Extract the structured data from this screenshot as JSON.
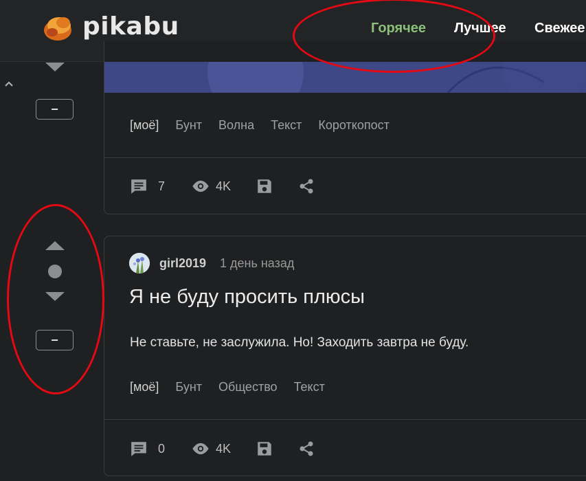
{
  "header": {
    "logo_text": "pikabu",
    "tabs": [
      {
        "label": "Горячее",
        "active": true
      },
      {
        "label": "Лучшее",
        "active": false
      },
      {
        "label": "Свежее",
        "active": false
      }
    ],
    "accent_color": "#8ac07a"
  },
  "rail": {
    "top_minus_label": "−",
    "bottom_minus_label": "−"
  },
  "post_top": {
    "tags": [
      "[моё]",
      "Бунт",
      "Волна",
      "Текст",
      "Короткопост"
    ],
    "comments": "7",
    "views": "4K"
  },
  "post_bottom": {
    "author": "girl2019",
    "time": "1 день назад",
    "title": "Я не буду просить плюсы",
    "body": "Не ставьте, не заслужила. Но! Заходить завтра не буду.",
    "tags": [
      "[моё]",
      "Бунт",
      "Общество",
      "Текст"
    ],
    "comments": "0",
    "views": "4K"
  },
  "icons": {
    "comment": "comment-icon",
    "views": "eye-icon",
    "save": "save-icon",
    "share": "share-icon"
  },
  "annotation_color": "#e50914"
}
